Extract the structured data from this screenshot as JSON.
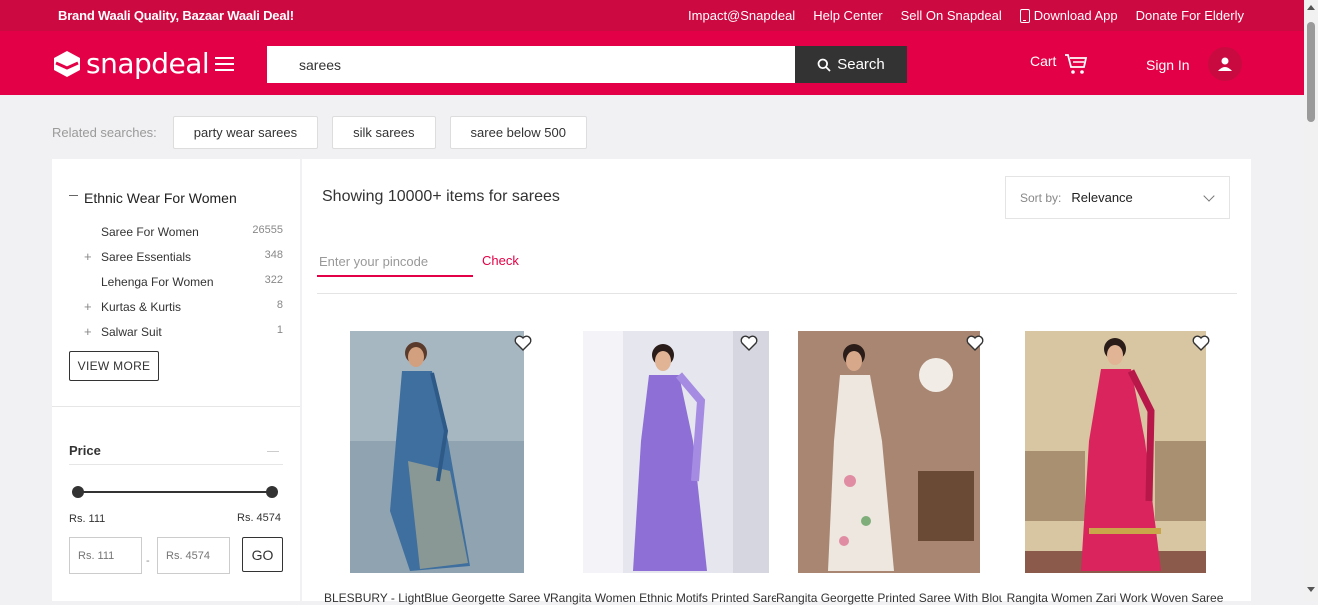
{
  "topbar": {
    "tagline": "Brand Waali Quality, Bazaar Waali Deal!",
    "links": [
      "Impact@Snapdeal",
      "Help Center",
      "Sell On Snapdeal",
      "Download App",
      "Donate For Elderly"
    ]
  },
  "header": {
    "logo": "snapdeal",
    "search_value": "sarees",
    "search_button": "Search",
    "cart_label": "Cart",
    "signin_label": "Sign In"
  },
  "related": {
    "label": "Related searches:",
    "chips": [
      "party wear sarees",
      "silk sarees",
      "saree below 500"
    ]
  },
  "sidebar": {
    "category_title": "Ethnic Wear For Women",
    "subcategories": [
      {
        "name": "Saree For Women",
        "count": "26555",
        "expandable": false
      },
      {
        "name": "Saree Essentials",
        "count": "348",
        "expandable": true
      },
      {
        "name": "Lehenga For Women",
        "count": "322",
        "expandable": false
      },
      {
        "name": "Kurtas & Kurtis",
        "count": "8",
        "expandable": true
      },
      {
        "name": "Salwar Suit",
        "count": "1",
        "expandable": true
      }
    ],
    "view_more": "VIEW MORE",
    "price": {
      "title": "Price",
      "min_label": "Rs. 111",
      "max_label": "Rs. 4574",
      "min_placeholder": "Rs. 111",
      "max_placeholder": "Rs. 4574",
      "go_label": "GO"
    }
  },
  "main": {
    "showing_text": "Showing 10000+ items for sarees",
    "sort_label": "Sort by:",
    "sort_value": "Relevance",
    "pincode_placeholder": "Enter your pincode",
    "check_label": "Check"
  },
  "products": [
    {
      "title": "BLESBURY - LightBlue Georgette Saree With Blouse Piece",
      "saree_color": "#3f6f9e",
      "bg_color": "#8fa3b1"
    },
    {
      "title": "Rangita Women Ethnic Motifs Printed Saree",
      "saree_color": "#8d6fd6",
      "bg_color": "#e6e6ee"
    },
    {
      "title": "Rangita Georgette Printed Saree With Blouse",
      "saree_color": "#ede7df",
      "bg_color": "#a98672"
    },
    {
      "title": "Rangita Women Zari Work Woven Saree",
      "saree_color": "#d9245e",
      "bg_color": "#d8c6a2"
    }
  ],
  "colors": {
    "brand": "#e40046",
    "topbar": "#cd0941",
    "search_button": "#333333"
  }
}
